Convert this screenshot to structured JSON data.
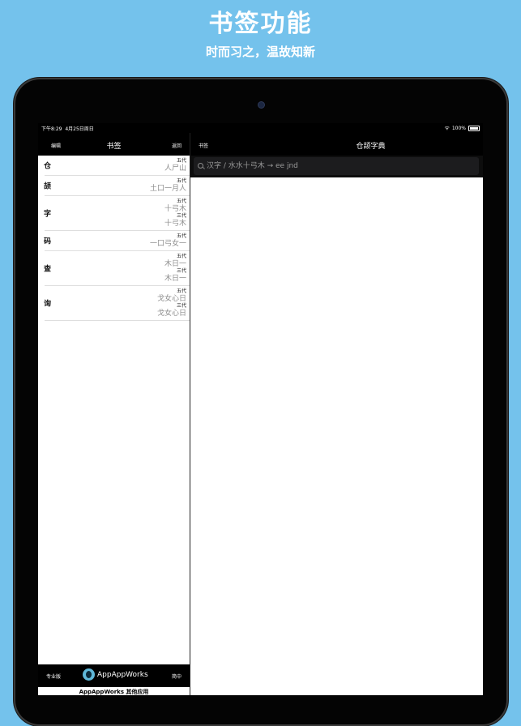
{
  "promo": {
    "headline": "书签功能",
    "subline": "时而习之，温故知新"
  },
  "status": {
    "time": "下午8:29",
    "date": "4月25日周日",
    "battery": "100%"
  },
  "left_nav": {
    "edit": "编辑",
    "title": "书签",
    "back": "返回"
  },
  "bookmarks": [
    {
      "char": "仓",
      "codes": [
        {
          "gen": "五代",
          "code": "人尸山"
        }
      ]
    },
    {
      "char": "颉",
      "codes": [
        {
          "gen": "五代",
          "code": "土口一月人"
        }
      ]
    },
    {
      "char": "字",
      "codes": [
        {
          "gen": "五代",
          "code": "十弓木"
        },
        {
          "gen": "三代",
          "code": "十弓木"
        }
      ]
    },
    {
      "char": "码",
      "codes": [
        {
          "gen": "五代",
          "code": "一口弓女一"
        }
      ]
    },
    {
      "char": "查",
      "codes": [
        {
          "gen": "五代",
          "code": "木日一"
        },
        {
          "gen": "三代",
          "code": "木日一"
        }
      ]
    },
    {
      "char": "询",
      "codes": [
        {
          "gen": "五代",
          "code": "戈女心日"
        },
        {
          "gen": "三代",
          "code": "戈女心日"
        }
      ]
    }
  ],
  "left_footer": {
    "pro": "专业版",
    "brand": "AppAppWorks",
    "lang": "简中",
    "other_apps": "AppAppWorks 其他应用"
  },
  "right_nav": {
    "bookmarks": "书签",
    "title": "仓颉字典"
  },
  "search": {
    "placeholder": "汉字 / 水水十弓木 → ee jnd"
  },
  "icons": {
    "wifi": "wifi-icon",
    "battery": "battery-icon",
    "search": "search-icon",
    "logo": "appappworks-logo"
  }
}
